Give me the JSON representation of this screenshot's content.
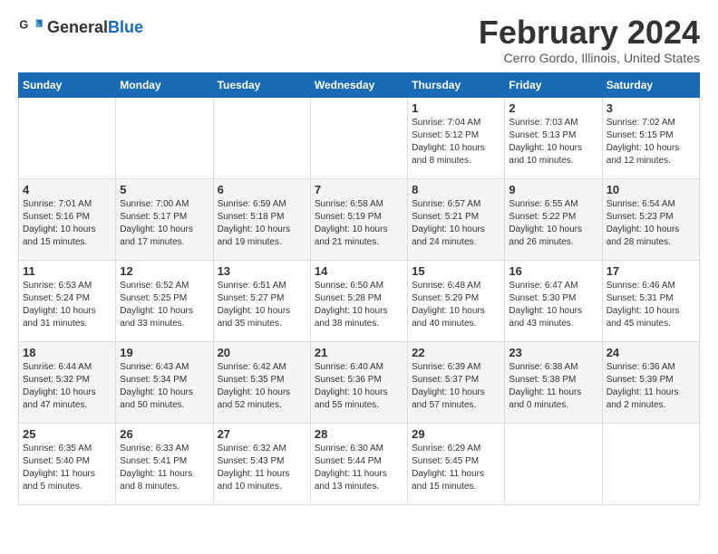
{
  "header": {
    "logo_general": "General",
    "logo_blue": "Blue",
    "month_title": "February 2024",
    "location": "Cerro Gordo, Illinois, United States"
  },
  "weekdays": [
    "Sunday",
    "Monday",
    "Tuesday",
    "Wednesday",
    "Thursday",
    "Friday",
    "Saturday"
  ],
  "weeks": [
    [
      {
        "day": "",
        "info": ""
      },
      {
        "day": "",
        "info": ""
      },
      {
        "day": "",
        "info": ""
      },
      {
        "day": "",
        "info": ""
      },
      {
        "day": "1",
        "info": "Sunrise: 7:04 AM\nSunset: 5:12 PM\nDaylight: 10 hours\nand 8 minutes."
      },
      {
        "day": "2",
        "info": "Sunrise: 7:03 AM\nSunset: 5:13 PM\nDaylight: 10 hours\nand 10 minutes."
      },
      {
        "day": "3",
        "info": "Sunrise: 7:02 AM\nSunset: 5:15 PM\nDaylight: 10 hours\nand 12 minutes."
      }
    ],
    [
      {
        "day": "4",
        "info": "Sunrise: 7:01 AM\nSunset: 5:16 PM\nDaylight: 10 hours\nand 15 minutes."
      },
      {
        "day": "5",
        "info": "Sunrise: 7:00 AM\nSunset: 5:17 PM\nDaylight: 10 hours\nand 17 minutes."
      },
      {
        "day": "6",
        "info": "Sunrise: 6:59 AM\nSunset: 5:18 PM\nDaylight: 10 hours\nand 19 minutes."
      },
      {
        "day": "7",
        "info": "Sunrise: 6:58 AM\nSunset: 5:19 PM\nDaylight: 10 hours\nand 21 minutes."
      },
      {
        "day": "8",
        "info": "Sunrise: 6:57 AM\nSunset: 5:21 PM\nDaylight: 10 hours\nand 24 minutes."
      },
      {
        "day": "9",
        "info": "Sunrise: 6:55 AM\nSunset: 5:22 PM\nDaylight: 10 hours\nand 26 minutes."
      },
      {
        "day": "10",
        "info": "Sunrise: 6:54 AM\nSunset: 5:23 PM\nDaylight: 10 hours\nand 28 minutes."
      }
    ],
    [
      {
        "day": "11",
        "info": "Sunrise: 6:53 AM\nSunset: 5:24 PM\nDaylight: 10 hours\nand 31 minutes."
      },
      {
        "day": "12",
        "info": "Sunrise: 6:52 AM\nSunset: 5:25 PM\nDaylight: 10 hours\nand 33 minutes."
      },
      {
        "day": "13",
        "info": "Sunrise: 6:51 AM\nSunset: 5:27 PM\nDaylight: 10 hours\nand 35 minutes."
      },
      {
        "day": "14",
        "info": "Sunrise: 6:50 AM\nSunset: 5:28 PM\nDaylight: 10 hours\nand 38 minutes."
      },
      {
        "day": "15",
        "info": "Sunrise: 6:48 AM\nSunset: 5:29 PM\nDaylight: 10 hours\nand 40 minutes."
      },
      {
        "day": "16",
        "info": "Sunrise: 6:47 AM\nSunset: 5:30 PM\nDaylight: 10 hours\nand 43 minutes."
      },
      {
        "day": "17",
        "info": "Sunrise: 6:46 AM\nSunset: 5:31 PM\nDaylight: 10 hours\nand 45 minutes."
      }
    ],
    [
      {
        "day": "18",
        "info": "Sunrise: 6:44 AM\nSunset: 5:32 PM\nDaylight: 10 hours\nand 47 minutes."
      },
      {
        "day": "19",
        "info": "Sunrise: 6:43 AM\nSunset: 5:34 PM\nDaylight: 10 hours\nand 50 minutes."
      },
      {
        "day": "20",
        "info": "Sunrise: 6:42 AM\nSunset: 5:35 PM\nDaylight: 10 hours\nand 52 minutes."
      },
      {
        "day": "21",
        "info": "Sunrise: 6:40 AM\nSunset: 5:36 PM\nDaylight: 10 hours\nand 55 minutes."
      },
      {
        "day": "22",
        "info": "Sunrise: 6:39 AM\nSunset: 5:37 PM\nDaylight: 10 hours\nand 57 minutes."
      },
      {
        "day": "23",
        "info": "Sunrise: 6:38 AM\nSunset: 5:38 PM\nDaylight: 11 hours\nand 0 minutes."
      },
      {
        "day": "24",
        "info": "Sunrise: 6:36 AM\nSunset: 5:39 PM\nDaylight: 11 hours\nand 2 minutes."
      }
    ],
    [
      {
        "day": "25",
        "info": "Sunrise: 6:35 AM\nSunset: 5:40 PM\nDaylight: 11 hours\nand 5 minutes."
      },
      {
        "day": "26",
        "info": "Sunrise: 6:33 AM\nSunset: 5:41 PM\nDaylight: 11 hours\nand 8 minutes."
      },
      {
        "day": "27",
        "info": "Sunrise: 6:32 AM\nSunset: 5:43 PM\nDaylight: 11 hours\nand 10 minutes."
      },
      {
        "day": "28",
        "info": "Sunrise: 6:30 AM\nSunset: 5:44 PM\nDaylight: 11 hours\nand 13 minutes."
      },
      {
        "day": "29",
        "info": "Sunrise: 6:29 AM\nSunset: 5:45 PM\nDaylight: 11 hours\nand 15 minutes."
      },
      {
        "day": "",
        "info": ""
      },
      {
        "day": "",
        "info": ""
      }
    ]
  ]
}
